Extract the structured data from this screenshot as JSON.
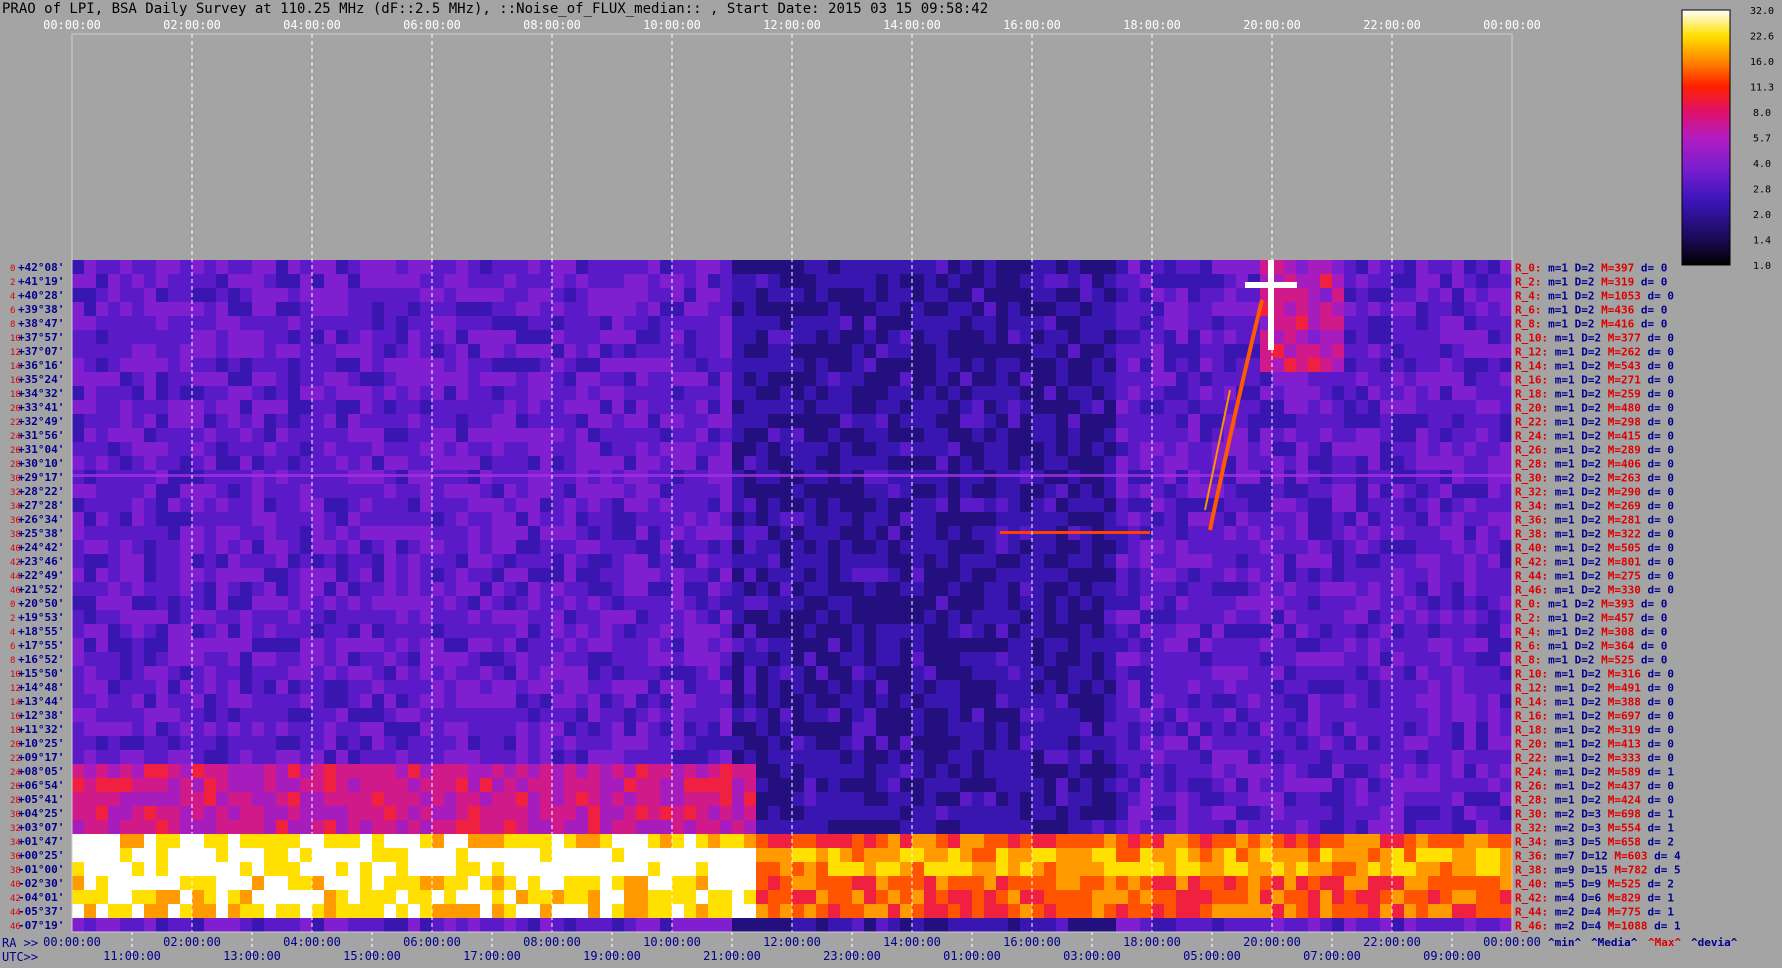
{
  "title": "PRAO of LPI, BSA Daily Survey at 110.25 MHz (dF::2.5 MHz), ::Noise_of_FLUX_median:: , Start Date: 2015 03 15 09:58:42",
  "colors": {
    "background": "#a4a4a4",
    "grid": "#ffffff",
    "label_red": "#dd0000",
    "label_blue": "#00008b"
  },
  "footer": {
    "ra_label": "RA >>",
    "utc_label": "UTC>>",
    "stat_labels": [
      {
        "text": "^min^",
        "color": "#00008b"
      },
      {
        "text": "^Media^",
        "color": "#00008b"
      },
      {
        "text": "^Max^",
        "color": "#dd0000"
      },
      {
        "text": "^devia^",
        "color": "#00008b"
      }
    ]
  },
  "chart_data": {
    "type": "heatmap",
    "x_top_ticks": [
      "00:00:00",
      "02:00:00",
      "04:00:00",
      "06:00:00",
      "08:00:00",
      "10:00:00",
      "12:00:00",
      "14:00:00",
      "16:00:00",
      "18:00:00",
      "20:00:00",
      "22:00:00",
      "00:00:00"
    ],
    "x_bottom_ra_ticks": [
      "00:00:00",
      "02:00:00",
      "04:00:00",
      "06:00:00",
      "08:00:00",
      "10:00:00",
      "12:00:00",
      "14:00:00",
      "16:00:00",
      "18:00:00",
      "20:00:00",
      "22:00:00",
      "00:00:00"
    ],
    "x_bottom_utc_ticks": [
      "11:00:00",
      "13:00:00",
      "15:00:00",
      "17:00:00",
      "19:00:00",
      "21:00:00",
      "23:00:00",
      "01:00:00",
      "03:00:00",
      "05:00:00",
      "07:00:00",
      "09:00:00"
    ],
    "y_labels": [
      "+42°08'",
      "+41°19'",
      "+40°28'",
      "+39°38'",
      "+38°47'",
      "+37°57'",
      "+37°07'",
      "+36°16'",
      "+35°24'",
      "+34°32'",
      "+33°41'",
      "+32°49'",
      "+31°56'",
      "+31°04'",
      "+30°10'",
      "+29°17'",
      "+28°22'",
      "+27°28'",
      "+26°34'",
      "+25°38'",
      "+24°42'",
      "+23°46'",
      "+22°49'",
      "+21°52'",
      "+20°50'",
      "+19°53'",
      "+18°55'",
      "+17°55'",
      "+16°52'",
      "+15°50'",
      "+14°48'",
      "+13°44'",
      "+12°38'",
      "+11°32'",
      "+10°25'",
      "+09°17'",
      "+08°05'",
      "+06°54'",
      "+05°41'",
      "+04°25'",
      "+03°07'",
      "+01°47'",
      "+00°25'",
      "-01°00'",
      "-02°30'",
      "-04°01'",
      "-05°37'",
      "-07°19'"
    ],
    "row_indices": [
      "0",
      "2",
      "4",
      "6",
      "8",
      "10",
      "12",
      "14",
      "16",
      "18",
      "20",
      "22",
      "24",
      "26",
      "28",
      "30",
      "32",
      "34",
      "36",
      "38",
      "40",
      "42",
      "44",
      "46",
      "0",
      "2",
      "4",
      "6",
      "8",
      "10",
      "12",
      "14",
      "16",
      "18",
      "20",
      "22",
      "24",
      "26",
      "28",
      "30",
      "32",
      "34",
      "36",
      "38",
      "40",
      "42",
      "44",
      "46"
    ],
    "colorbar": {
      "ticks": [
        "32.0",
        "22.6",
        "16.0",
        "11.3",
        "8.0",
        "5.7",
        "4.0",
        "2.8",
        "2.0",
        "1.4",
        "1.0"
      ],
      "range": [
        1.0,
        32.0
      ],
      "scale": "log"
    },
    "rows": [
      {
        "r": "R_0:",
        "m": "1",
        "D": "2",
        "M": "397",
        "d": "0"
      },
      {
        "r": "R_2:",
        "m": "1",
        "D": "2",
        "M": "319",
        "d": "0"
      },
      {
        "r": "R_4:",
        "m": "1",
        "D": "2",
        "M": "1053",
        "d": "0"
      },
      {
        "r": "R_6:",
        "m": "1",
        "D": "2",
        "M": "436",
        "d": "0"
      },
      {
        "r": "R_8:",
        "m": "1",
        "D": "2",
        "M": "416",
        "d": "0"
      },
      {
        "r": "R_10:",
        "m": "1",
        "D": "2",
        "M": "377",
        "d": "0"
      },
      {
        "r": "R_12:",
        "m": "1",
        "D": "2",
        "M": "262",
        "d": "0"
      },
      {
        "r": "R_14:",
        "m": "1",
        "D": "2",
        "M": "543",
        "d": "0"
      },
      {
        "r": "R_16:",
        "m": "1",
        "D": "2",
        "M": "271",
        "d": "0"
      },
      {
        "r": "R_18:",
        "m": "1",
        "D": "2",
        "M": "259",
        "d": "0"
      },
      {
        "r": "R_20:",
        "m": "1",
        "D": "2",
        "M": "480",
        "d": "0"
      },
      {
        "r": "R_22:",
        "m": "1",
        "D": "2",
        "M": "298",
        "d": "0"
      },
      {
        "r": "R_24:",
        "m": "1",
        "D": "2",
        "M": "415",
        "d": "0"
      },
      {
        "r": "R_26:",
        "m": "1",
        "D": "2",
        "M": "289",
        "d": "0"
      },
      {
        "r": "R_28:",
        "m": "1",
        "D": "2",
        "M": "406",
        "d": "0"
      },
      {
        "r": "R_30:",
        "m": "2",
        "D": "2",
        "M": "263",
        "d": "0"
      },
      {
        "r": "R_32:",
        "m": "1",
        "D": "2",
        "M": "290",
        "d": "0"
      },
      {
        "r": "R_34:",
        "m": "1",
        "D": "2",
        "M": "269",
        "d": "0"
      },
      {
        "r": "R_36:",
        "m": "1",
        "D": "2",
        "M": "281",
        "d": "0"
      },
      {
        "r": "R_38:",
        "m": "1",
        "D": "2",
        "M": "322",
        "d": "0"
      },
      {
        "r": "R_40:",
        "m": "1",
        "D": "2",
        "M": "505",
        "d": "0"
      },
      {
        "r": "R_42:",
        "m": "1",
        "D": "2",
        "M": "801",
        "d": "0"
      },
      {
        "r": "R_44:",
        "m": "1",
        "D": "2",
        "M": "275",
        "d": "0"
      },
      {
        "r": "R_46:",
        "m": "1",
        "D": "2",
        "M": "330",
        "d": "0"
      },
      {
        "r": "R_0:",
        "m": "1",
        "D": "2",
        "M": "393",
        "d": "0"
      },
      {
        "r": "R_2:",
        "m": "1",
        "D": "2",
        "M": "457",
        "d": "0"
      },
      {
        "r": "R_4:",
        "m": "1",
        "D": "2",
        "M": "308",
        "d": "0"
      },
      {
        "r": "R_6:",
        "m": "1",
        "D": "2",
        "M": "364",
        "d": "0"
      },
      {
        "r": "R_8:",
        "m": "1",
        "D": "2",
        "M": "525",
        "d": "0"
      },
      {
        "r": "R_10:",
        "m": "1",
        "D": "2",
        "M": "316",
        "d": "0"
      },
      {
        "r": "R_12:",
        "m": "1",
        "D": "2",
        "M": "491",
        "d": "0"
      },
      {
        "r": "R_14:",
        "m": "1",
        "D": "2",
        "M": "388",
        "d": "0"
      },
      {
        "r": "R_16:",
        "m": "1",
        "D": "2",
        "M": "697",
        "d": "0"
      },
      {
        "r": "R_18:",
        "m": "1",
        "D": "2",
        "M": "319",
        "d": "0"
      },
      {
        "r": "R_20:",
        "m": "1",
        "D": "2",
        "M": "413",
        "d": "0"
      },
      {
        "r": "R_22:",
        "m": "1",
        "D": "2",
        "M": "333",
        "d": "0"
      },
      {
        "r": "R_24:",
        "m": "1",
        "D": "2",
        "M": "589",
        "d": "1"
      },
      {
        "r": "R_26:",
        "m": "1",
        "D": "2",
        "M": "437",
        "d": "0"
      },
      {
        "r": "R_28:",
        "m": "1",
        "D": "2",
        "M": "424",
        "d": "0"
      },
      {
        "r": "R_30:",
        "m": "2",
        "D": "3",
        "M": "698",
        "d": "1"
      },
      {
        "r": "R_32:",
        "m": "2",
        "D": "3",
        "M": "554",
        "d": "1"
      },
      {
        "r": "R_34:",
        "m": "3",
        "D": "5",
        "M": "658",
        "d": "2"
      },
      {
        "r": "R_36:",
        "m": "7",
        "D": "12",
        "M": "603",
        "d": "4"
      },
      {
        "r": "R_38:",
        "m": "9",
        "D": "15",
        "M": "782",
        "d": "5"
      },
      {
        "r": "R_40:",
        "m": "5",
        "D": "9",
        "M": "525",
        "d": "2"
      },
      {
        "r": "R_42:",
        "m": "4",
        "D": "6",
        "M": "829",
        "d": "1"
      },
      {
        "r": "R_44:",
        "m": "2",
        "D": "4",
        "M": "775",
        "d": "1"
      },
      {
        "r": "R_46:",
        "m": "2",
        "D": "4",
        "M": "1088",
        "d": "1"
      }
    ]
  }
}
